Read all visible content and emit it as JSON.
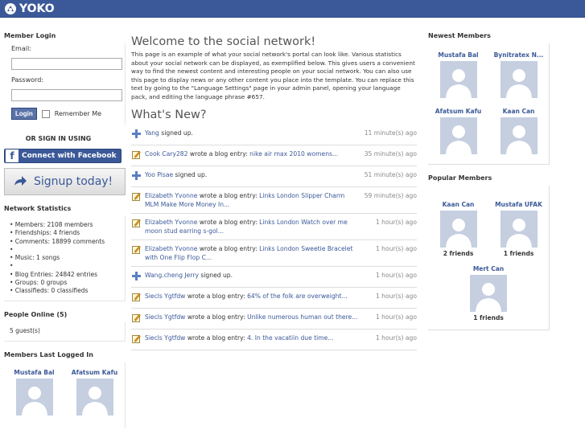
{
  "brand": {
    "logo_text": "YOKO"
  },
  "login": {
    "title": "Member Login",
    "email_label": "Email:",
    "password_label": "Password:",
    "login_button": "Login",
    "remember_label": "Remember Me",
    "or_sign_in": "OR SIGN IN USING",
    "facebook_button": "Connect with Facebook",
    "signup_button": "Signup today!"
  },
  "stats": {
    "title": "Network Statistics",
    "items": [
      "• Members: 2108 members",
      "• Friendships: 4 friends",
      "• Comments: 18899 comments",
      "•",
      "• Music: 1 songs",
      "•",
      "• Blog Entries: 24842 entries",
      "• Groups: 0 groups",
      "• Classifieds: 0 classifieds"
    ]
  },
  "online": {
    "title": "People Online (5)",
    "text": "5 guest(s)"
  },
  "last_logged": {
    "title": "Members Last Logged In",
    "members": [
      "Mustafa Bal",
      "Afatsum Kafu"
    ]
  },
  "main": {
    "welcome_title": "Welcome to the social network!",
    "intro": "This page is an example of what your social network's portal can look like. Various statistics about your social network can be displayed, as exemplified below. This gives users a convenient way to find the newest content and interesting people on your social network. You can also use this page to display news or any other content you place into the template. You can replace this text by going to the \"Language Settings\" page in your admin panel, opening your language pack, and editing the language phrase #657.",
    "whats_new_title": "What's New?",
    "feed": [
      {
        "icon": "plus-icon",
        "user": "Yang",
        "action": " signed up.",
        "link": "",
        "time": "11 minute(s) ago"
      },
      {
        "icon": "blog-icon",
        "user": "Cook Cary282",
        "action": " wrote a blog entry: ",
        "link": "nike air max 2010 womens...",
        "time": "35 minute(s) ago"
      },
      {
        "icon": "plus-icon",
        "user": "Yoo Pisae",
        "action": " signed up.",
        "link": "",
        "time": "51 minute(s) ago"
      },
      {
        "icon": "blog-icon",
        "user": "Elizabeth Yvonne",
        "action": " wrote a blog entry: ",
        "link": "Links London Slipper Charm MLM Make More Money In...",
        "time": "59 minute(s) ago"
      },
      {
        "icon": "blog-icon",
        "user": "Elizabeth Yvonne",
        "action": " wrote a blog entry: ",
        "link": "Links London Watch over me moon stud earring s-gol...",
        "time": "1 hour(s) ago"
      },
      {
        "icon": "blog-icon",
        "user": "Elizabeth Yvonne",
        "action": " wrote a blog entry: ",
        "link": "Links London Sweetie Bracelet with One Flip Flop C...",
        "time": "1 hour(s) ago"
      },
      {
        "icon": "plus-icon",
        "user": "Wang.cheng Jerry",
        "action": " signed up.",
        "link": "",
        "time": "1 hour(s) ago"
      },
      {
        "icon": "blog-icon",
        "user": "Siecls Ygtfdw",
        "action": " wrote a blog entry: ",
        "link": "64% of the folk are overweight...",
        "time": "1 hour(s) ago"
      },
      {
        "icon": "blog-icon",
        "user": "Siecls Ygtfdw",
        "action": " wrote a blog entry: ",
        "link": "Unlike numerous human out there...",
        "time": "1 hour(s) ago"
      },
      {
        "icon": "blog-icon",
        "user": "Siecls Ygtfdw",
        "action": " wrote a blog entry: ",
        "link": "4. In the vacatiin due time...",
        "time": "1 hour(s) ago"
      }
    ]
  },
  "newest": {
    "title": "Newest Members",
    "members": [
      "Mustafa Bal",
      "Bynitratex N...",
      "Afatsum Kafu",
      "Kaan Can"
    ]
  },
  "popular": {
    "title": "Popular Members",
    "members": [
      {
        "name": "Kaan Can",
        "friends": "2 friends"
      },
      {
        "name": "Mustafa UFAK",
        "friends": "1 friends"
      },
      {
        "name": "Mert Can",
        "friends": "1 friends"
      }
    ]
  },
  "colors": {
    "brand": "#3b5998",
    "avatar": "#c5cfe0"
  }
}
